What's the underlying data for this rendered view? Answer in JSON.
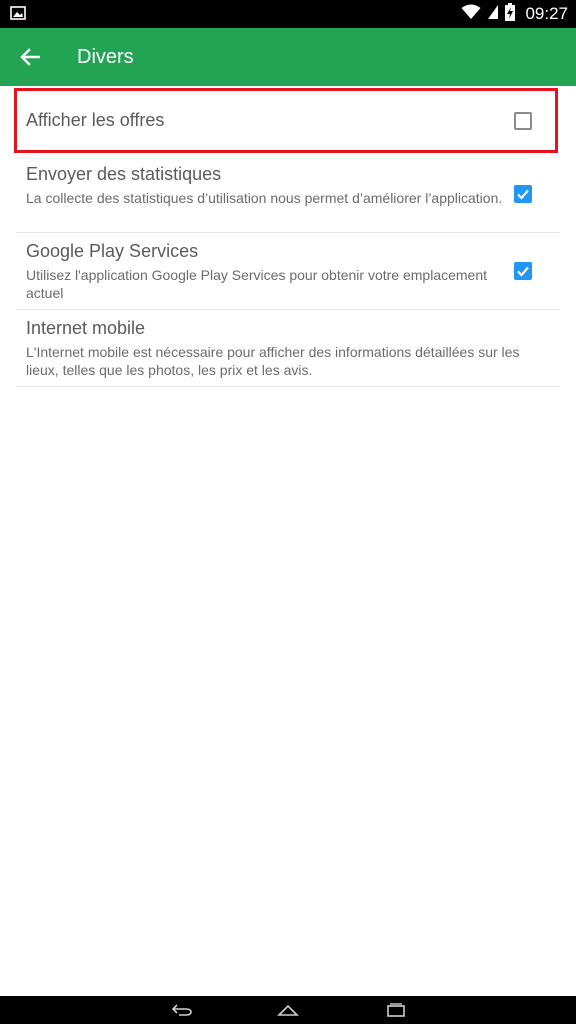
{
  "status_bar": {
    "time": "09:27",
    "icons": [
      "image-icon",
      "wifi-icon",
      "signal-icon",
      "battery-charging-icon"
    ]
  },
  "toolbar": {
    "back_icon": "arrow-left-icon",
    "title": "Divers",
    "background_color": "#23a455"
  },
  "preferences": [
    {
      "title": "Afficher les offres",
      "summary": "",
      "checked": false,
      "highlighted": true
    },
    {
      "title": "Envoyer des statistiques",
      "summary": "La collecte des statistiques d’utilisation nous permet d’améliorer l’application.",
      "checked": true
    },
    {
      "title": "Google Play Services",
      "summary": "Utilisez l'application Google Play Services pour obtenir votre emplacement actuel",
      "checked": true
    },
    {
      "title": "Internet mobile",
      "summary": "L'Internet mobile est nécessaire pour afficher des informations détaillées sur les lieux, telles que les photos, les prix et les avis."
    }
  ],
  "colors": {
    "accent_checkbox": "#2196f3",
    "highlight_border": "#e3121d"
  },
  "nav_bar": {
    "icons": [
      "back-nav-icon",
      "home-nav-icon",
      "recents-nav-icon"
    ]
  }
}
